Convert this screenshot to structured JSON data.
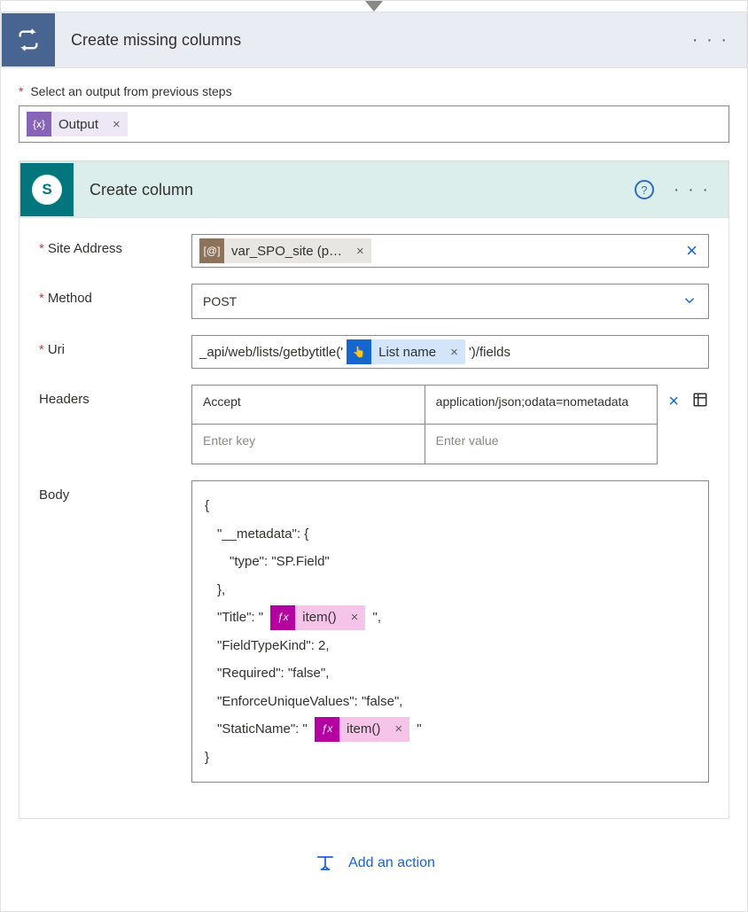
{
  "outer": {
    "title": "Create missing columns",
    "menu": "· · ·",
    "selectLabel": "Select an output from previous steps",
    "outputToken": "Output"
  },
  "inner": {
    "title": "Create column",
    "menu": "· · ·",
    "fields": {
      "siteAddress": {
        "label": "Site Address",
        "token": "var_SPO_site (p…"
      },
      "method": {
        "label": "Method",
        "value": "POST"
      },
      "uri": {
        "label": "Uri",
        "prefix": "_api/web/lists/getbytitle('",
        "token": "List name",
        "suffix": "')/fields"
      },
      "headers": {
        "label": "Headers",
        "rows": [
          {
            "key": "Accept",
            "value": "application/json;odata=nometadata"
          }
        ],
        "keyPlaceholder": "Enter key",
        "valuePlaceholder": "Enter value"
      },
      "body": {
        "label": "Body",
        "lines": {
          "open": "{",
          "meta1": "\"__metadata\": {",
          "meta2": "\"type\": \"SP.Field\"",
          "meta3": "},",
          "titlePre": "\"Title\": \"",
          "titlePost": "\",",
          "ftk": "\"FieldTypeKind\": 2,",
          "req": "\"Required\": \"false\",",
          "euv": "\"EnforceUniqueValues\": \"false\",",
          "snPre": "\"StaticName\": \"",
          "snPost": "\"",
          "close": "}"
        },
        "itemToken": "item()"
      }
    }
  },
  "addAction": "Add an action",
  "icons": {
    "fx": "ƒx",
    "variable": "{x}",
    "at": "[@]",
    "hand": "👆",
    "spLetter": "S"
  }
}
